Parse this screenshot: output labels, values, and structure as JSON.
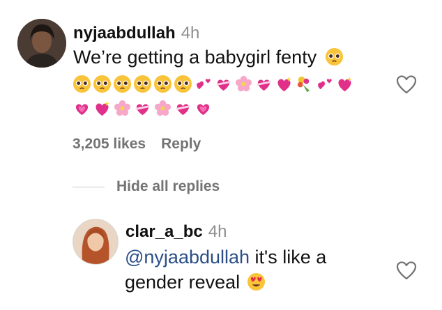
{
  "comment": {
    "username": "nyjaabdullah",
    "time": "4h",
    "text": "We’re getting a babygirl fenty",
    "likes": "3,205 likes",
    "reply_label": "Reply"
  },
  "replies_toggle": {
    "label": "Hide all replies"
  },
  "reply": {
    "username": "clar_a_bc",
    "time": "4h",
    "mention": "@nyjaabdullah",
    "text_line1": " it's like a",
    "text_line2": "gender reveal"
  },
  "colors": {
    "mention": "#2b4e88",
    "muted": "#8e8e8e",
    "heart_emoji": "#e0308a"
  }
}
